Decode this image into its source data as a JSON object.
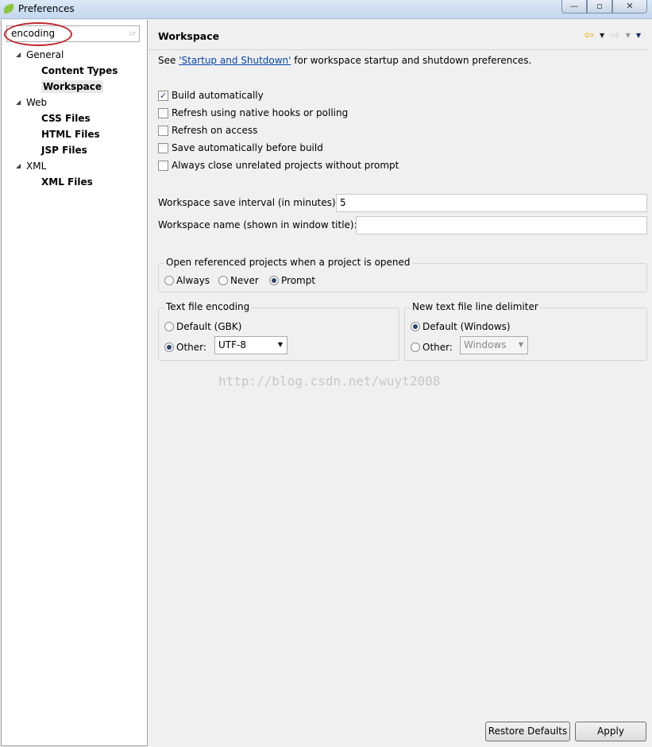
{
  "window": {
    "title": "Preferences",
    "minimize": "—",
    "maximize": "▫",
    "close": "✕"
  },
  "filter": {
    "value": "encoding",
    "clear_icon": "eraser-icon"
  },
  "tree": [
    {
      "label": "General",
      "children": [
        {
          "label": "Content Types"
        },
        {
          "label": "Workspace",
          "selected": true
        }
      ]
    },
    {
      "label": "Web",
      "children": [
        {
          "label": "CSS Files"
        },
        {
          "label": "HTML Files"
        },
        {
          "label": "JSP Files"
        }
      ]
    },
    {
      "label": "XML",
      "children": [
        {
          "label": "XML Files"
        }
      ]
    }
  ],
  "page": {
    "title": "Workspace",
    "see_prefix": "See ",
    "see_link": "'Startup and Shutdown'",
    "see_suffix": " for workspace startup and shutdown preferences.",
    "checkboxes": [
      {
        "label": "Build automatically",
        "checked": true
      },
      {
        "label": "Refresh using native hooks or polling",
        "checked": false
      },
      {
        "label": "Refresh on access",
        "checked": false
      },
      {
        "label": "Save automatically before build",
        "checked": false
      },
      {
        "label": "Always close unrelated projects without prompt",
        "checked": false
      }
    ],
    "save_interval_label": "Workspace save interval (in minutes):",
    "save_interval_value": "5",
    "ws_name_label": "Workspace name (shown in window title):",
    "ws_name_value": "",
    "open_ref": {
      "label": "Open referenced projects when a project is opened",
      "options": [
        "Always",
        "Never",
        "Prompt"
      ],
      "selected": "Prompt"
    },
    "encoding": {
      "label": "Text file encoding",
      "default": "Default (GBK)",
      "other": "Other:",
      "value": "UTF-8",
      "selected": "Other"
    },
    "delimiter": {
      "label": "New text file line delimiter",
      "default": "Default (Windows)",
      "other": "Other:",
      "value": "Windows",
      "selected": "Default"
    },
    "watermark": "http://blog.csdn.net/wuyt2008"
  },
  "buttons": {
    "restore": "Restore Defaults",
    "apply": "Apply"
  },
  "colors": {
    "accent_link": "#0645ad",
    "annotation_circle": "#c0282d",
    "back_arrow": "#f1b416"
  }
}
